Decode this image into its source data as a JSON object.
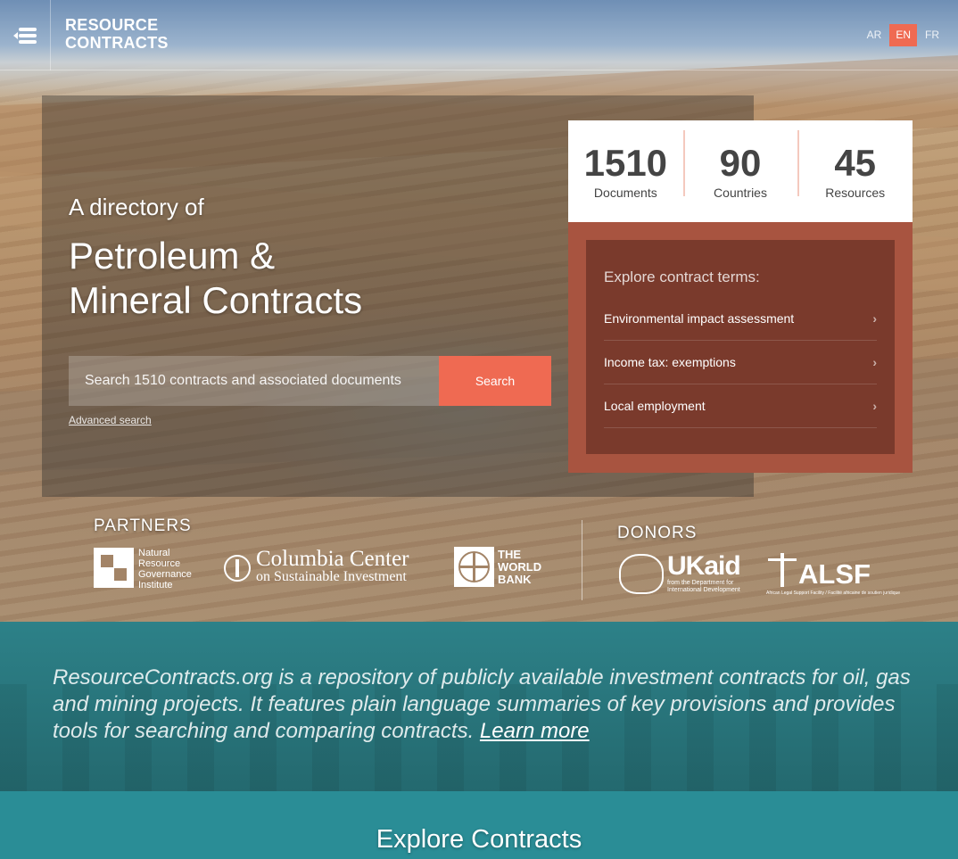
{
  "header": {
    "logo_line1": "RESOURCE",
    "logo_line2": "CONTRACTS",
    "languages": [
      "AR",
      "EN",
      "FR"
    ],
    "active_language": "EN"
  },
  "hero": {
    "tagline": "A directory of",
    "headline_line1": "Petroleum &",
    "headline_line2": "Mineral Contracts",
    "search_placeholder": "Search 1510 contracts and associated documents",
    "search_button": "Search",
    "advanced_search": "Advanced search"
  },
  "stats": [
    {
      "value": "1510",
      "label": "Documents"
    },
    {
      "value": "90",
      "label": "Countries"
    },
    {
      "value": "45",
      "label": "Resources"
    }
  ],
  "terms": {
    "title": "Explore contract terms:",
    "items": [
      "Environmental impact assessment",
      "Income tax: exemptions",
      "Local employment"
    ]
  },
  "partners": {
    "label": "PARTNERS",
    "nrgi": [
      "Natural",
      "Resource",
      "Governance",
      "Institute"
    ],
    "columbia_line1": "Columbia Center",
    "columbia_line2": "on Sustainable Investment",
    "worldbank": [
      "THE",
      "WORLD",
      "BANK"
    ]
  },
  "donors": {
    "label": "DONORS",
    "ukaid": "UKaid",
    "ukaid_sub1": "from the Department for",
    "ukaid_sub2": "International Development",
    "alsf": "ALSF",
    "alsf_sub": "African Legal Support Facility / Facilité africaine de soutien juridique"
  },
  "about": {
    "text": "ResourceContracts.org is a repository of publicly available investment contracts for oil, gas and mining projects. It features plain language summaries of key provisions and provides tools for searching and comparing contracts.",
    "link": "Learn more"
  },
  "explore": {
    "title": "Explore Contracts"
  },
  "colors": {
    "accent": "#ef6a52",
    "terms_outer": "#a85440",
    "terms_inner": "#7a3a2c",
    "teal": "#2a8d96"
  },
  "icons": {
    "menu": "menu-icon",
    "chevron": "chevron-right-icon"
  }
}
